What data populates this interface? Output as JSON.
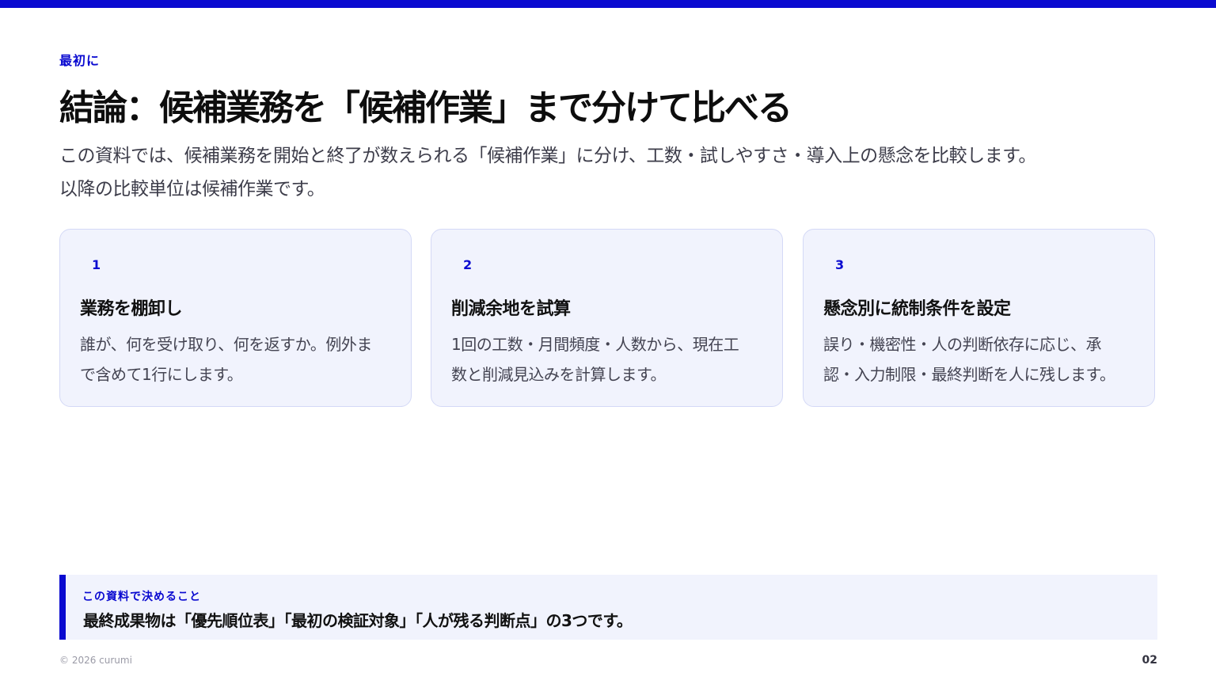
{
  "header": {
    "eyebrow": "最初に",
    "title": "結論：候補業務を「候補作業」まで分けて比べる",
    "lead_line1": "この資料では、候補業務を開始と終了が数えられる「候補作業」に分け、工数・試しやすさ・導入上の懸念を比較します。",
    "lead_line2": "以降の比較単位は候補作業です。"
  },
  "cards": [
    {
      "num": "1",
      "title": "業務を棚卸し",
      "body_line1": "誰が、何を受け取り、何を返すか。例外ま",
      "body_line2": "で含めて1行にします。"
    },
    {
      "num": "2",
      "title": "削減余地を試算",
      "body_line1": "1回の工数・月間頻度・人数から、現在工",
      "body_line2": "数と削減見込みを計算します。"
    },
    {
      "num": "3",
      "title": "懸念別に統制条件を設定",
      "body_line1": "誤り・機密性・人の判断依存に応じ、承",
      "body_line2": "認・入力制限・最終判断を人に残します。"
    }
  ],
  "decision": {
    "label": "この資料で決めること",
    "text": "最終成果物は「優先順位表」「最初の検証対象」「人が残る判断点」の3つです。"
  },
  "footer": {
    "copyright": "© 2026 curumi",
    "page": "02"
  },
  "colors": {
    "accent": "#0a0ad0",
    "card_bg": "#f1f3fd",
    "card_border": "#d4d9f6"
  }
}
